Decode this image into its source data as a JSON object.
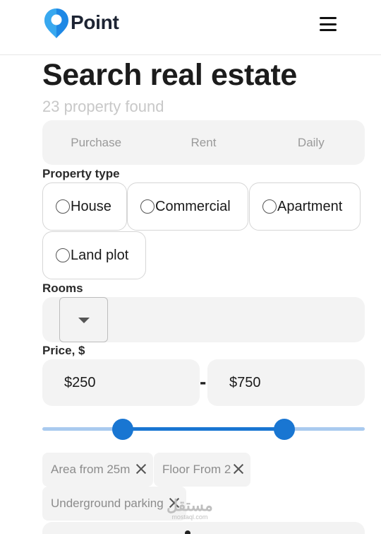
{
  "header": {
    "brand": "Point",
    "colors": {
      "brand_blue": "#1e88e5",
      "brand_dark": "#1d2433"
    },
    "menu_icon": "hamburger-icon"
  },
  "main": {
    "title": "Search real estate",
    "subtitle": "23 property found",
    "deal_tabs": [
      {
        "label": "Purchase"
      },
      {
        "label": "Rent"
      },
      {
        "label": "Daily"
      }
    ],
    "property_type": {
      "label": "Property type",
      "options": [
        {
          "label": "House",
          "checked": false
        },
        {
          "label": "Commercial",
          "checked": false
        },
        {
          "label": "Apartment",
          "checked": false
        },
        {
          "label": "Land plot",
          "checked": false
        }
      ]
    },
    "rooms": {
      "label": "Rooms",
      "selected_value": ""
    },
    "price": {
      "label": "Price, $",
      "min": "$250",
      "separator": "-",
      "max": "$750",
      "range_fraction": {
        "from": 0.25,
        "to": 0.75
      },
      "accent": "#1976d2"
    },
    "filters": [
      {
        "label": "Area from 25m"
      },
      {
        "label": "Floor From 2"
      },
      {
        "label": "Underground parking"
      }
    ],
    "watermark": {
      "arabic": "مستقل",
      "latin": "mostaql.com"
    }
  }
}
